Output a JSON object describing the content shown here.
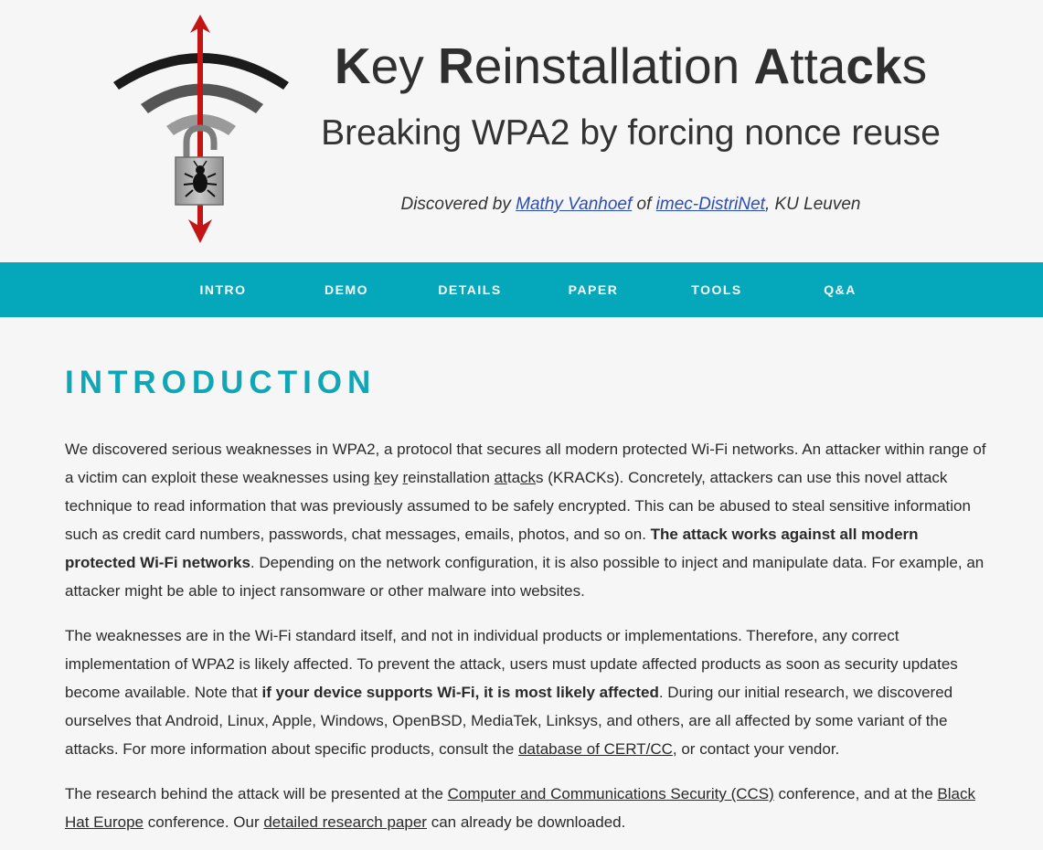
{
  "header": {
    "title_parts": [
      {
        "text": "K",
        "bold": true
      },
      {
        "text": "ey ",
        "bold": false
      },
      {
        "text": "R",
        "bold": true
      },
      {
        "text": "einstallation ",
        "bold": false
      },
      {
        "text": "A",
        "bold": true
      },
      {
        "text": "tta",
        "bold": false
      },
      {
        "text": "ck",
        "bold": true
      },
      {
        "text": "s",
        "bold": false
      }
    ],
    "subtitle": "Breaking WPA2 by forcing nonce reuse",
    "credits": {
      "prefix": "Discovered by ",
      "author": "Mathy Vanhoef",
      "middle": " of ",
      "org": "imec-DistriNet",
      "suffix": ", KU Leuven"
    }
  },
  "nav": {
    "items": [
      "INTRO",
      "DEMO",
      "DETAILS",
      "PAPER",
      "TOOLS",
      "Q&A"
    ]
  },
  "intro": {
    "heading": "INTRODUCTION",
    "p1": {
      "a": "We discovered serious weaknesses in WPA2, a protocol that secures all modern protected Wi-Fi networks. An attacker within range of a victim can exploit these weaknesses using ",
      "k": "k",
      "ey": "ey ",
      "r": "r",
      "einstallation": "einstallation ",
      "at": "at",
      "ta": "ta",
      "ck": "ck",
      "s_tail": "s (KRACKs). Concretely, attackers can use this novel attack technique to read information that was previously assumed to be safely encrypted. This can be abused to steal sensitive information such as credit card numbers, passwords, chat messages, emails, photos, and so on. ",
      "bold": "The attack works against all modern protected Wi-Fi networks",
      "b": ". Depending on the network configuration, it is also possible to inject and manipulate data. For example, an attacker might be able to inject ransomware or other malware into websites."
    },
    "p2": {
      "a": "The weaknesses are in the Wi-Fi standard itself, and not in individual products or implementations. Therefore, any correct implementation of WPA2 is likely affected. To prevent the attack, users must update affected products as soon as security updates become available. Note that ",
      "bold": "if your device supports Wi-Fi, it is most likely affected",
      "b": ". During our initial research, we discovered ourselves that Android, Linux, Apple, Windows, OpenBSD, MediaTek, Linksys, and others, are all affected by some variant of the attacks. For more information about specific products, consult the ",
      "link": "database of CERT/CC",
      "c": ", or contact your vendor."
    },
    "p3": {
      "a": "The research behind the attack will be presented at the ",
      "link1": "Computer and Communications Security (CCS)",
      "b": " conference, and at the ",
      "link2": "Black Hat Europe",
      "c": " conference. Our ",
      "link3": "detailed research paper",
      "d": " can already be downloaded."
    }
  }
}
